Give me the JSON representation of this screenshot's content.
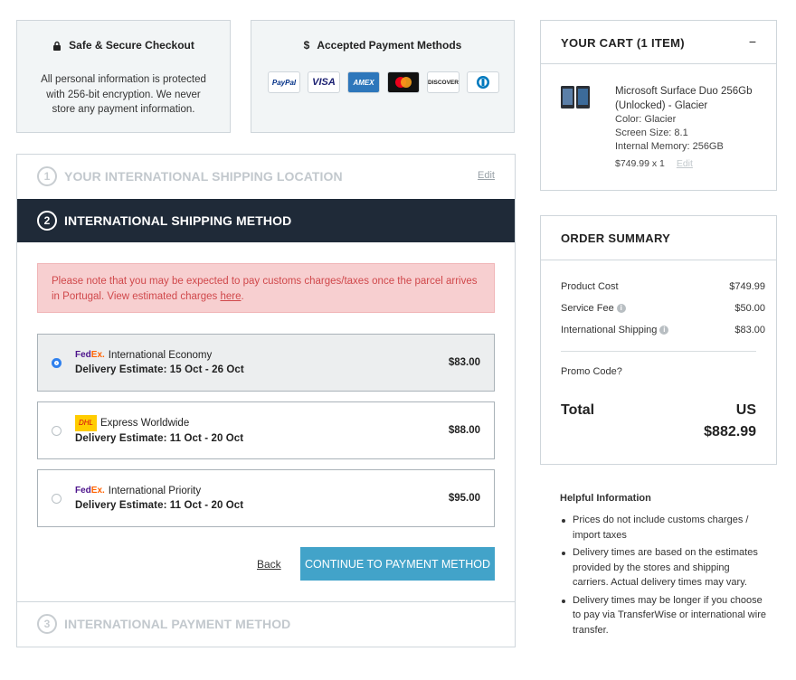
{
  "secure": {
    "title": "Safe & Secure Checkout",
    "text": "All personal information is protected with 256-bit encryption. We never store any payment information."
  },
  "payments": {
    "title": "Accepted Payment Methods",
    "methods": [
      {
        "name": "PayPal",
        "icon": "paypal-icon",
        "color": "#003087"
      },
      {
        "name": "VISA",
        "icon": "visa-icon",
        "color": "#1a1f71"
      },
      {
        "name": "AMEX",
        "icon": "amex-icon",
        "color": "#2e77bb"
      },
      {
        "name": "",
        "icon": "mastercard-icon",
        "color": "#eb001b"
      },
      {
        "name": "DISCOVER",
        "icon": "discover-icon",
        "color": "#f58220"
      },
      {
        "name": "",
        "icon": "diners-icon",
        "color": "#0079be"
      }
    ]
  },
  "steps": {
    "step1": {
      "num": "1",
      "label": "YOUR INTERNATIONAL SHIPPING LOCATION",
      "edit": "Edit"
    },
    "step2": {
      "num": "2",
      "label": "INTERNATIONAL SHIPPING METHOD"
    },
    "step3": {
      "num": "3",
      "label": "INTERNATIONAL PAYMENT METHOD"
    }
  },
  "notice": {
    "text": "Please note that you may be expected to pay customs charges/taxes once the parcel arrives in Portugal. View estimated charges ",
    "link": "here",
    "end": "."
  },
  "shipping_options": [
    {
      "carrier": "FedEx",
      "name": "International Economy",
      "estimate": "Delivery Estimate: 15 Oct - 26 Oct",
      "price": "$83.00",
      "selected": true
    },
    {
      "carrier": "DHL",
      "name": "Express Worldwide",
      "estimate": "Delivery Estimate: 11 Oct - 20 Oct",
      "price": "$88.00",
      "selected": false
    },
    {
      "carrier": "FedEx",
      "name": "International Priority",
      "estimate": "Delivery Estimate: 11 Oct - 20 Oct",
      "price": "$95.00",
      "selected": false
    }
  ],
  "carrier_labels": {
    "fedex_fe": "Fed",
    "fedex_ex": "Ex.",
    "dhl": "DHL"
  },
  "actions": {
    "back": "Back",
    "continue": "CONTINUE TO PAYMENT METHOD"
  },
  "cart": {
    "title": "YOUR CART (1 ITEM)",
    "toggle": "−",
    "item": {
      "name": "Microsoft Surface Duo 256Gb (Unlocked) - Glacier",
      "color": "Color: Glacier",
      "screen": "Screen Size: 8.1",
      "memory": "Internal Memory: 256GB",
      "price_qty": "$749.99 x 1",
      "edit": "Edit"
    }
  },
  "summary": {
    "title": "ORDER SUMMARY",
    "product_cost_label": "Product Cost",
    "product_cost": "$749.99",
    "service_fee_label": "Service Fee",
    "service_fee": "$50.00",
    "shipping_label": "International Shipping",
    "shipping": "$83.00",
    "promo": "Promo Code?",
    "total_label": "Total",
    "currency": "US",
    "total": "$882.99"
  },
  "help": {
    "title": "Helpful Information",
    "items": [
      "Prices do not include customs charges / import taxes",
      "Delivery times are based on the estimates provided by the stores and shipping carriers. Actual delivery times may vary.",
      "Delivery times may be longer if you choose to pay via TransferWise or international wire transfer."
    ]
  }
}
